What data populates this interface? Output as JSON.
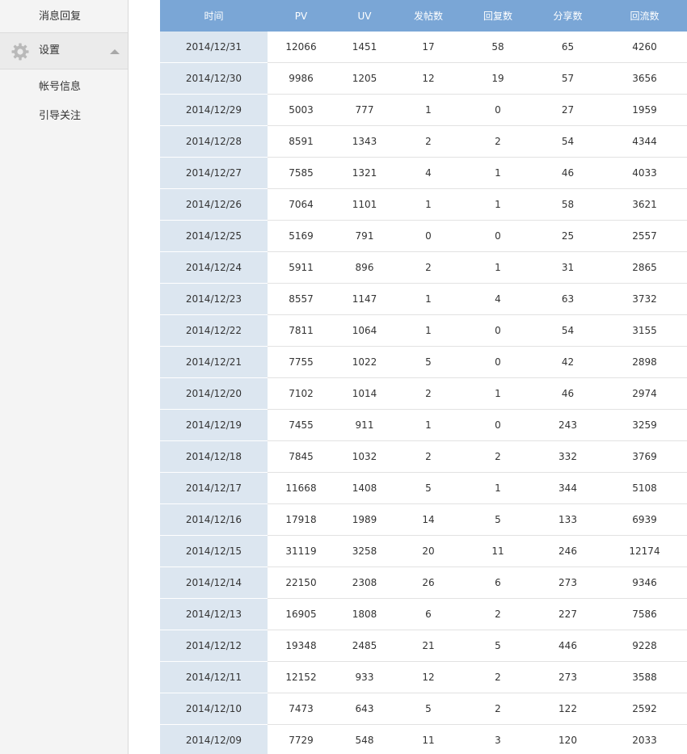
{
  "sidebar": {
    "items": [
      {
        "label": "消息回复"
      },
      {
        "label": "设置"
      },
      {
        "label": "帐号信息"
      },
      {
        "label": "引导关注"
      }
    ]
  },
  "table": {
    "headers": [
      "时间",
      "PV",
      "UV",
      "发帖数",
      "回复数",
      "分享数",
      "回流数"
    ],
    "rows": [
      [
        "2014/12/31",
        "12066",
        "1451",
        "17",
        "58",
        "65",
        "4260"
      ],
      [
        "2014/12/30",
        "9986",
        "1205",
        "12",
        "19",
        "57",
        "3656"
      ],
      [
        "2014/12/29",
        "5003",
        "777",
        "1",
        "0",
        "27",
        "1959"
      ],
      [
        "2014/12/28",
        "8591",
        "1343",
        "2",
        "2",
        "54",
        "4344"
      ],
      [
        "2014/12/27",
        "7585",
        "1321",
        "4",
        "1",
        "46",
        "4033"
      ],
      [
        "2014/12/26",
        "7064",
        "1101",
        "1",
        "1",
        "58",
        "3621"
      ],
      [
        "2014/12/25",
        "5169",
        "791",
        "0",
        "0",
        "25",
        "2557"
      ],
      [
        "2014/12/24",
        "5911",
        "896",
        "2",
        "1",
        "31",
        "2865"
      ],
      [
        "2014/12/23",
        "8557",
        "1147",
        "1",
        "4",
        "63",
        "3732"
      ],
      [
        "2014/12/22",
        "7811",
        "1064",
        "1",
        "0",
        "54",
        "3155"
      ],
      [
        "2014/12/21",
        "7755",
        "1022",
        "5",
        "0",
        "42",
        "2898"
      ],
      [
        "2014/12/20",
        "7102",
        "1014",
        "2",
        "1",
        "46",
        "2974"
      ],
      [
        "2014/12/19",
        "7455",
        "911",
        "1",
        "0",
        "243",
        "3259"
      ],
      [
        "2014/12/18",
        "7845",
        "1032",
        "2",
        "2",
        "332",
        "3769"
      ],
      [
        "2014/12/17",
        "11668",
        "1408",
        "5",
        "1",
        "344",
        "5108"
      ],
      [
        "2014/12/16",
        "17918",
        "1989",
        "14",
        "5",
        "133",
        "6939"
      ],
      [
        "2014/12/15",
        "31119",
        "3258",
        "20",
        "11",
        "246",
        "12174"
      ],
      [
        "2014/12/14",
        "22150",
        "2308",
        "26",
        "6",
        "273",
        "9346"
      ],
      [
        "2014/12/13",
        "16905",
        "1808",
        "6",
        "2",
        "227",
        "7586"
      ],
      [
        "2014/12/12",
        "19348",
        "2485",
        "21",
        "5",
        "446",
        "9228"
      ],
      [
        "2014/12/11",
        "12152",
        "933",
        "12",
        "2",
        "273",
        "3588"
      ],
      [
        "2014/12/10",
        "7473",
        "643",
        "5",
        "2",
        "122",
        "2592"
      ],
      [
        "2014/12/09",
        "7729",
        "548",
        "11",
        "3",
        "120",
        "2033"
      ]
    ]
  },
  "colors": {
    "header_bg": "#7aa6d6",
    "date_col_bg": "#dce6f0",
    "sidebar_bg": "#f4f4f4"
  },
  "icons": {
    "settings": "gear-icon",
    "collapse": "caret-up-icon"
  }
}
